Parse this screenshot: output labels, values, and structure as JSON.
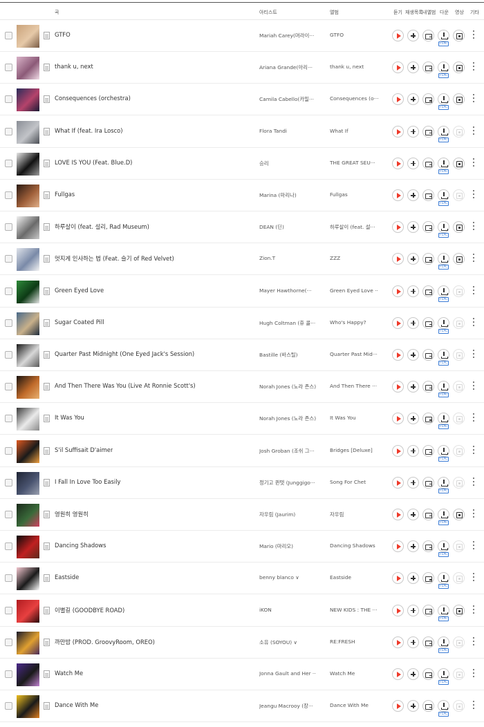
{
  "header": {
    "song": "곡",
    "artist": "아티스트",
    "album": "앨범",
    "listen": "듣기",
    "add": "재생목록",
    "mylist": "내앨범",
    "download": "다운",
    "video": "영상",
    "etc": "기타"
  },
  "flac_label": "FLAC",
  "rows": [
    {
      "title": "GTFO",
      "artist": "Mariah Carey(머라이···",
      "album": "GTFO",
      "mv": true,
      "thumb": [
        "#c9a27a",
        "#e6c9a8",
        "#7a5b45"
      ]
    },
    {
      "title": "thank u, next",
      "artist": "Ariana Grande(아리···",
      "album": "thank u, next",
      "mv": true,
      "thumb": [
        "#d9b3c8",
        "#8c5a78",
        "#f0dbe6"
      ]
    },
    {
      "title": "Consequences (orchestra)",
      "artist": "Camila Cabello(카밀···",
      "album": "Consequences (o···",
      "mv": true,
      "thumb": [
        "#2a2c5a",
        "#b5436b",
        "#1a1a35"
      ]
    },
    {
      "title": "What If (feat. Ira Losco)",
      "artist": "Flora Tandi",
      "album": "What If",
      "mv": false,
      "thumb": [
        "#8a8e96",
        "#c2c4c8",
        "#4b4e55"
      ]
    },
    {
      "title": "LOVE IS YOU (Feat. Blue.D)",
      "artist": "승리",
      "album": "THE GREAT SEU···",
      "mv": true,
      "thumb": [
        "#e8e8e8",
        "#111111",
        "#9a9a9a"
      ]
    },
    {
      "title": "Fullgas",
      "artist": "Marina (마리나)",
      "album": "Fullgas",
      "mv": false,
      "thumb": [
        "#2a1a12",
        "#a0603a",
        "#e0b08a"
      ]
    },
    {
      "title": "하루살이 (feat. 설리, Rad Museum)",
      "artist": "DEAN (딘)",
      "album": "하루살이 (feat. 설···",
      "mv": true,
      "thumb": [
        "#f2f2f2",
        "#6a6a6a",
        "#c8c8c8"
      ]
    },
    {
      "title": "멋지게 인사하는 법 (Feat. 슬기 of Red Velvet)",
      "artist": "Zion.T",
      "album": "ZZZ",
      "mv": true,
      "thumb": [
        "#dfe3ea",
        "#7a8aa8",
        "#f4f4f4"
      ]
    },
    {
      "title": "Green Eyed Love",
      "artist": "Mayer Hawthorne(···",
      "album": "Green Eyed Love ···",
      "mv": false,
      "thumb": [
        "#2f8a3a",
        "#0d3a15",
        "#e6e6e6"
      ]
    },
    {
      "title": "Sugar Coated Pill",
      "artist": "Hugh Coltman (휴 콜···",
      "album": "Who's Happy?",
      "mv": false,
      "thumb": [
        "#4a6a8a",
        "#c8b08a",
        "#1e2c3c"
      ]
    },
    {
      "title": "Quarter Past Midnight (One Eyed Jack's Session)",
      "artist": "Bastille (바스틸)",
      "album": "Quarter Past Mid···",
      "mv": false,
      "thumb": [
        "#1a1a1a",
        "#d8d8d8",
        "#5a5a5a"
      ]
    },
    {
      "title": "And Then There Was You (Live At Ronnie Scott's)",
      "artist": "Norah Jones (노라 존스)",
      "album": "And Then There ···",
      "mv": false,
      "thumb": [
        "#1a1410",
        "#c06a2a",
        "#e8b070"
      ]
    },
    {
      "title": "It Was You",
      "artist": "Norah Jones (노라 존스)",
      "album": "It Was You",
      "mv": false,
      "thumb": [
        "#3a3a3a",
        "#eaeaea",
        "#8a8a8a"
      ]
    },
    {
      "title": "S'il Suffisait D'aimer",
      "artist": "Josh Groban (조쉬 그···",
      "album": "Bridges [Deluxe]",
      "mv": false,
      "thumb": [
        "#e05a20",
        "#1a1a1a",
        "#f0a040"
      ]
    },
    {
      "title": "I Fall In Love Too Easily",
      "artist": "정기고 퀸텟 (Junggigo···",
      "album": "Song For Chet",
      "mv": false,
      "thumb": [
        "#1e2434",
        "#4a5470",
        "#9aa0b0"
      ]
    },
    {
      "title": "영원히 영원히",
      "artist": "자우림 (Jaurim)",
      "album": "자우림",
      "mv": true,
      "thumb": [
        "#1a2a1a",
        "#3a6a3a",
        "#d04060"
      ]
    },
    {
      "title": "Dancing Shadows",
      "artist": "Mario (마리오)",
      "album": "Dancing Shadows",
      "mv": false,
      "thumb": [
        "#0a0a0a",
        "#c02020",
        "#5a2a1a"
      ]
    },
    {
      "title": "Eastside",
      "artist": "benny blanco ∨",
      "album": "Eastside",
      "mv": false,
      "thumb": [
        "#f4c8d0",
        "#1a1a1a",
        "#ffffff"
      ]
    },
    {
      "title": "이별길 (GOODBYE ROAD)",
      "artist": "iKON",
      "album": "NEW KIDS : THE ···",
      "mv": true,
      "thumb": [
        "#b01c20",
        "#e84040",
        "#2a0a0a"
      ]
    },
    {
      "title": "까만밤 (PROD. GroovyRoom, OREO)",
      "artist": "소유 (SOYOU) ∨",
      "album": "RE:FRESH",
      "mv": false,
      "thumb": [
        "#1a1a2a",
        "#e0a030",
        "#4a2a5a"
      ]
    },
    {
      "title": "Watch Me",
      "artist": "Jonna Gault and Her ···",
      "album": "Watch Me",
      "mv": false,
      "thumb": [
        "#4a2a8a",
        "#1a1a1a",
        "#c080d0"
      ]
    },
    {
      "title": "Dance With Me",
      "artist": "Jeangu Macrooy (장···",
      "album": "Dance With Me",
      "mv": false,
      "thumb": [
        "#f0c020",
        "#1a1a1a",
        "#e08020"
      ]
    }
  ]
}
